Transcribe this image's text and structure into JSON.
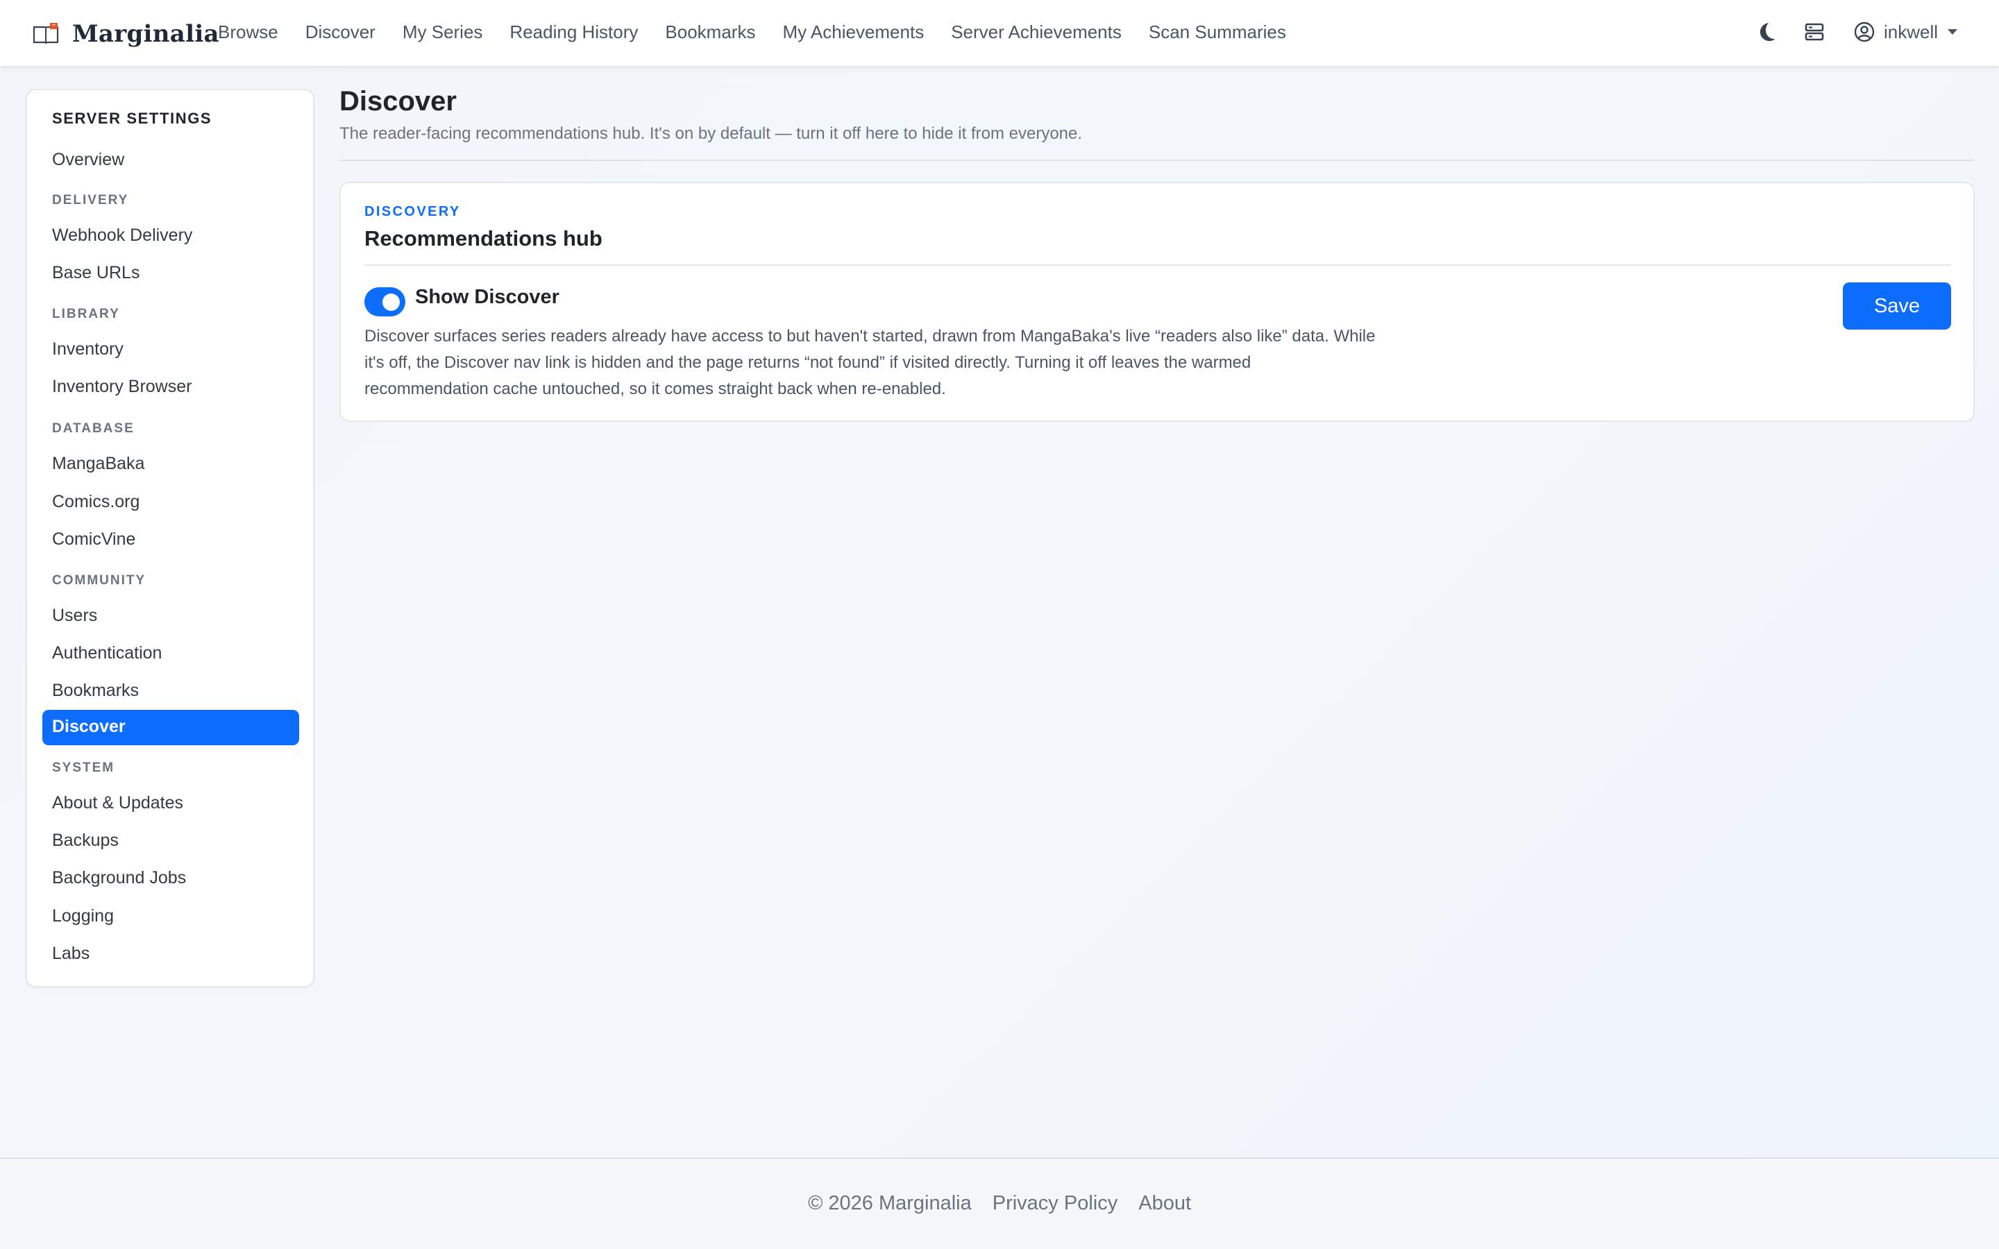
{
  "brand": {
    "name": "Marginalia"
  },
  "nav": {
    "links": [
      "Browse",
      "Discover",
      "My Series",
      "Reading History",
      "Bookmarks",
      "My Achievements",
      "Server Achievements",
      "Scan Summaries"
    ],
    "user": "inkwell",
    "icons": [
      "moon-icon",
      "server-icon",
      "user-circle-icon",
      "caret-down-icon"
    ]
  },
  "sidebar": {
    "title": "SERVER SETTINGS",
    "overview": "Overview",
    "sections": [
      {
        "heading": "DELIVERY",
        "items": [
          "Webhook Delivery",
          "Base URLs"
        ]
      },
      {
        "heading": "LIBRARY",
        "items": [
          "Inventory",
          "Inventory Browser"
        ]
      },
      {
        "heading": "DATABASE",
        "items": [
          "MangaBaka",
          "Comics.org",
          "ComicVine"
        ]
      },
      {
        "heading": "COMMUNITY",
        "items": [
          "Users",
          "Authentication",
          "Bookmarks",
          "Discover"
        ]
      },
      {
        "heading": "SYSTEM",
        "items": [
          "About & Updates",
          "Backups",
          "Background Jobs",
          "Logging",
          "Labs"
        ]
      }
    ],
    "active": "Discover"
  },
  "main": {
    "title": "Discover",
    "subtitle": "The reader-facing recommendations hub. It's on by default — turn it off here to hide it from everyone.",
    "card": {
      "kicker": "DISCOVERY",
      "title": "Recommendations hub",
      "toggle_label": "Show Discover",
      "toggle_on": true,
      "description": "Discover surfaces series readers already have access to but haven't started, drawn from MangaBaka's live “readers also like” data. While it's off, the Discover nav link is hidden and the page returns “not found” if visited directly. Turning it off leaves the warmed recommendation cache untouched, so it comes straight back when re-enabled.",
      "save_label": "Save"
    }
  },
  "footer": {
    "copyright": "© 2026 Marginalia",
    "links": [
      "Privacy Policy",
      "About"
    ]
  },
  "colors": {
    "accent": "#0d6efd",
    "text": "#212529",
    "muted": "#6b7280"
  }
}
